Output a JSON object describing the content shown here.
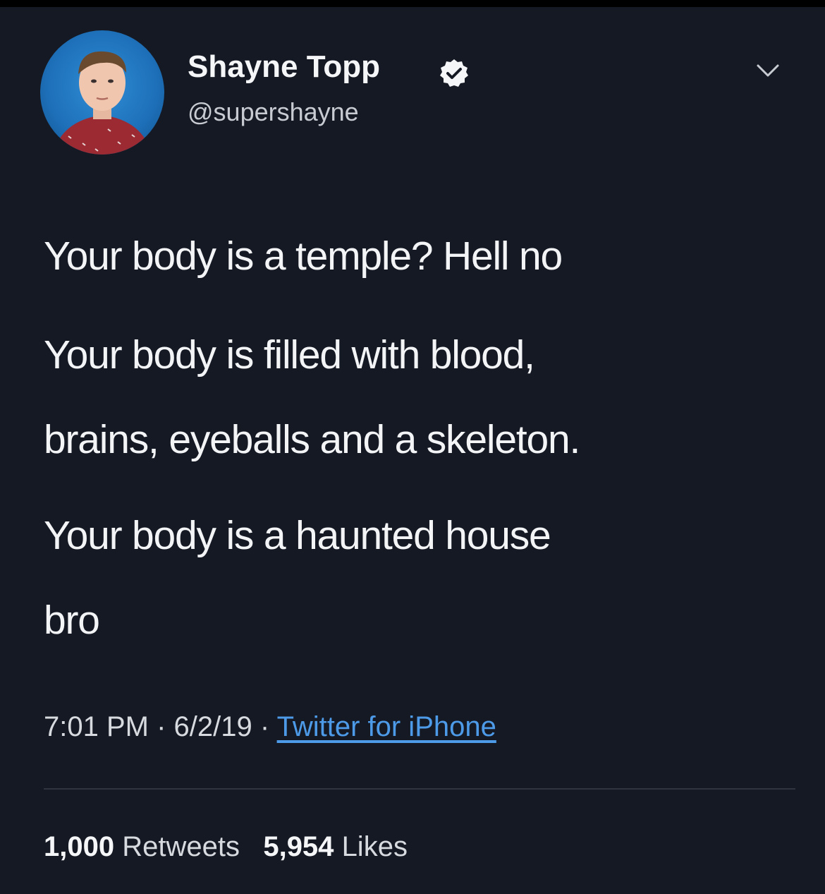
{
  "tweet": {
    "author": {
      "display_name": "Shayne Topp",
      "handle": "@supershayne",
      "verified_icon": "verified-badge-icon"
    },
    "menu_icon": "chevron-down-icon",
    "lines": [
      "Your body is a temple? Hell no",
      "Your body is filled with blood,",
      "brains, eyeballs and a skeleton.",
      "Your body is a haunted house",
      "bro"
    ],
    "meta": {
      "time": "7:01 PM",
      "date": "6/2/19",
      "separator": "·",
      "source": "Twitter for iPhone"
    },
    "stats": {
      "retweets_count": "1,000",
      "retweets_label": "Retweets",
      "likes_count": "5,954",
      "likes_label": "Likes"
    }
  },
  "colors": {
    "background": "#151924",
    "text": "#f3f4f6",
    "link": "#4d9be8"
  }
}
